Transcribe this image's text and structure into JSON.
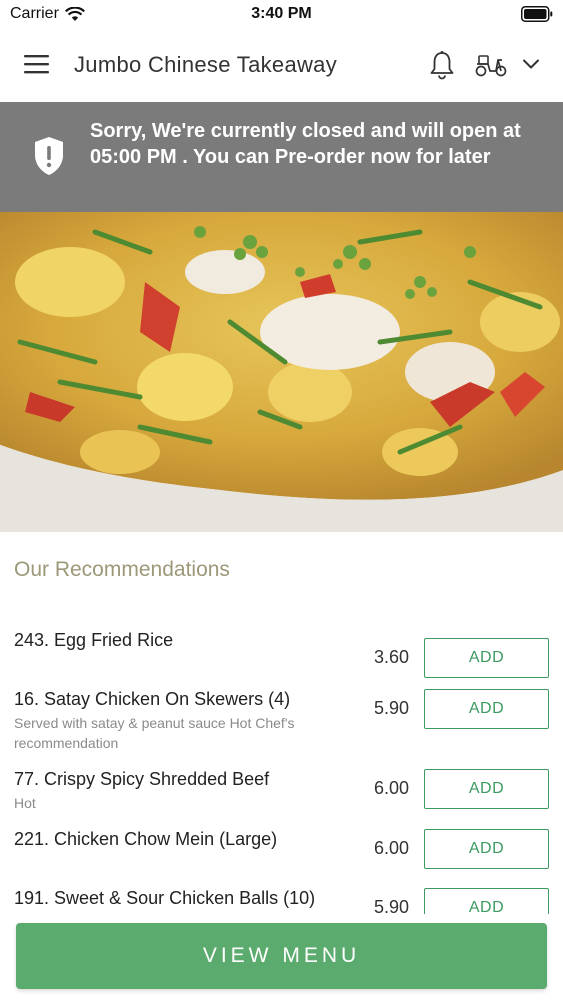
{
  "status_bar": {
    "carrier": "Carrier",
    "time": "3:40 PM"
  },
  "header": {
    "title": "Jumbo Chinese Takeaway",
    "icons": [
      "menu-icon",
      "bell-icon",
      "scooter-icon",
      "chevron-down-icon"
    ]
  },
  "banner": {
    "message": "Sorry, We're currently closed and will open at 05:00 PM . You can Pre-order now for later",
    "icon": "shield-icon",
    "background": "#7b7b7b"
  },
  "recommendations": {
    "title": "Our Recommendations",
    "items": [
      {
        "name": "243. Egg Fried Rice",
        "description": "",
        "price": "3.60",
        "button": "ADD"
      },
      {
        "name": "16. Satay Chicken On Skewers (4)",
        "description": "Served with satay & peanut sauce  Hot  Chef's recommendation",
        "price": "5.90",
        "button": "ADD"
      },
      {
        "name": "77. Crispy Spicy Shredded Beef",
        "description": "Hot",
        "price": "6.00",
        "button": "ADD"
      },
      {
        "name": "221. Chicken Chow Mein (Large)",
        "description": "",
        "price": "6.00",
        "button": "ADD"
      },
      {
        "name": "191. Sweet & Sour Chicken Balls (10)",
        "description": "",
        "price": "5.90",
        "button": "ADD"
      }
    ]
  },
  "view_menu_label": "VIEW MENU",
  "colors": {
    "accent": "#5aab6d",
    "add_border": "#3d9a61",
    "section_title": "#9c9878"
  }
}
